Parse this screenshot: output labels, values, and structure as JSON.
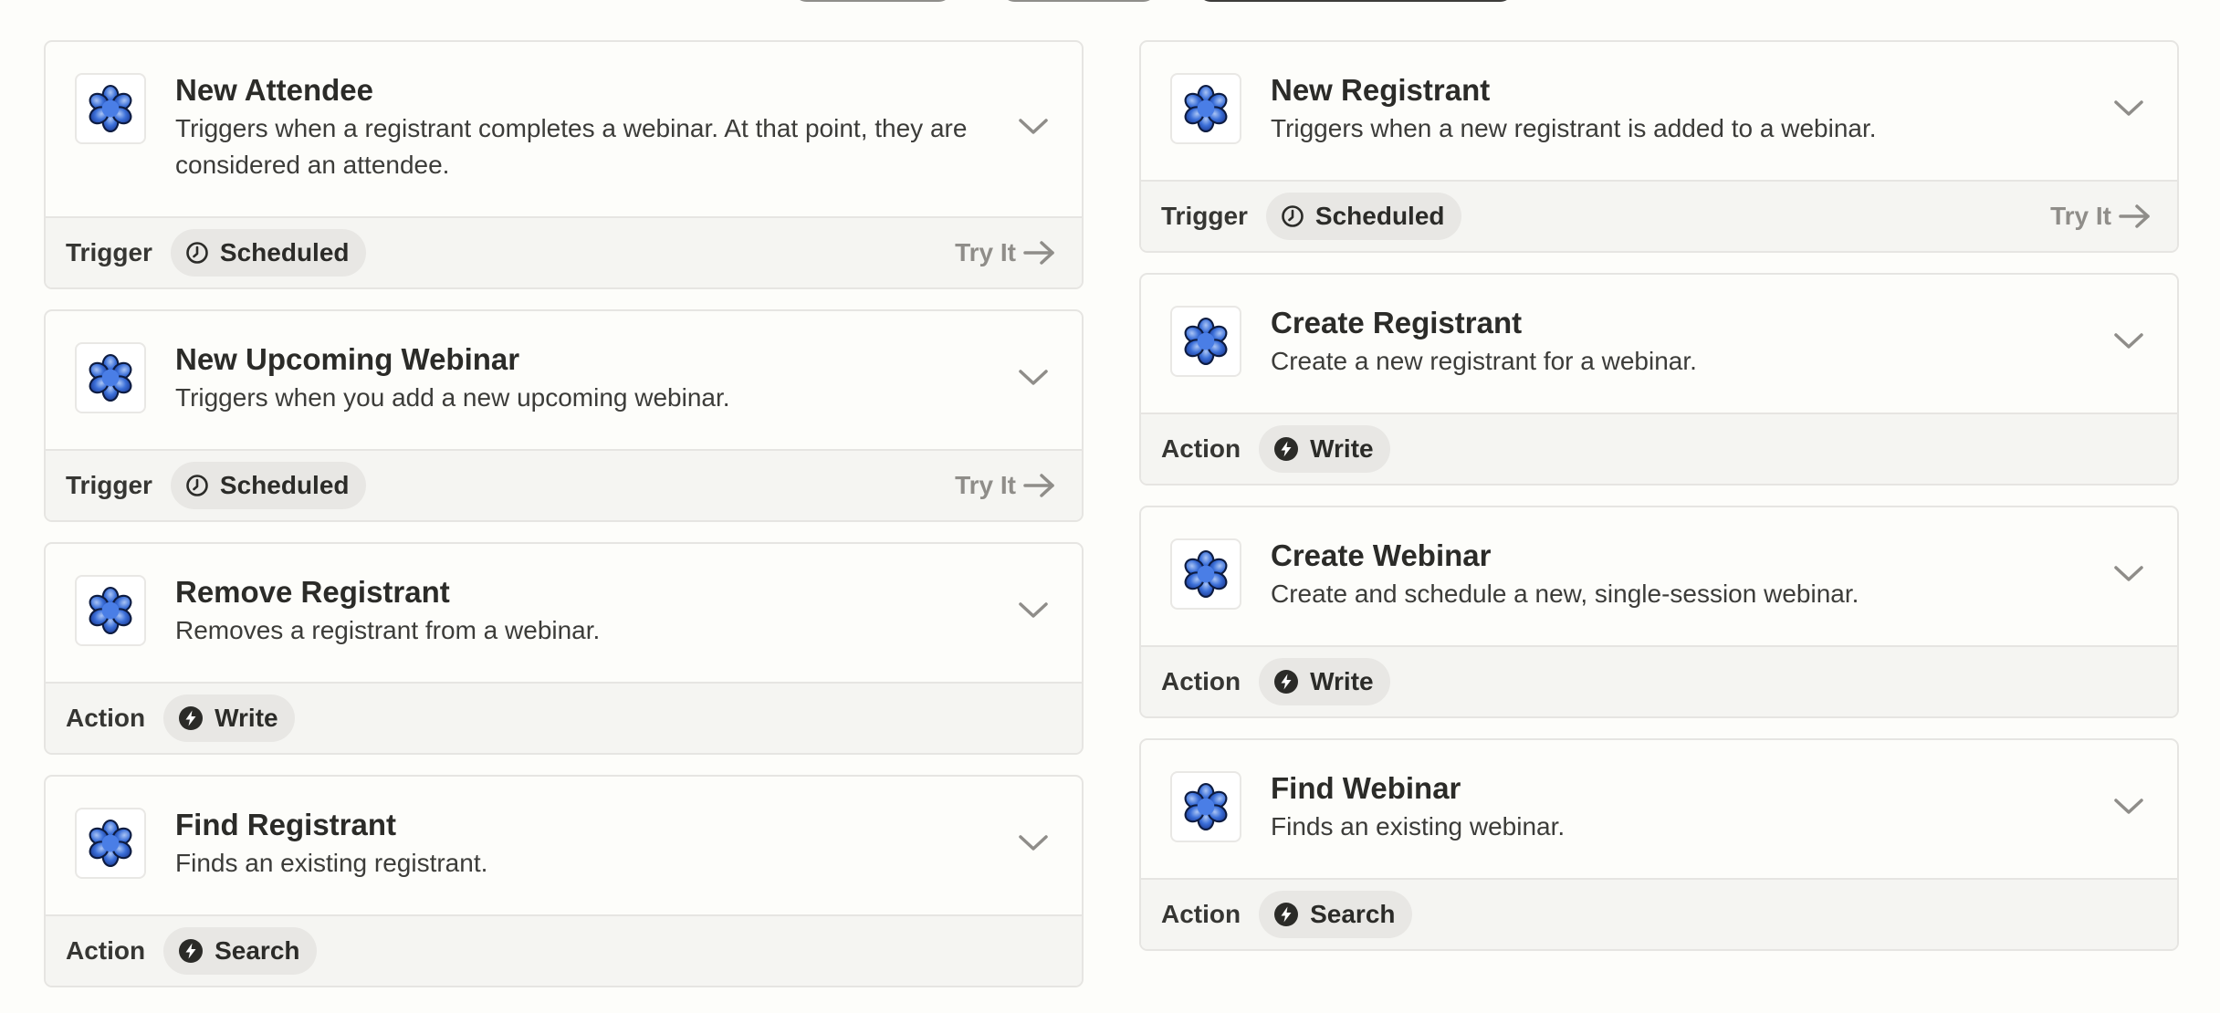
{
  "top_buttons": [
    {
      "style": "outline"
    },
    {
      "style": "outline"
    },
    {
      "style": "dark"
    }
  ],
  "colors": {
    "page_bg": "#fdfdfa",
    "footer_bg": "#f5f5f2",
    "badge_bg": "#e8e7e4",
    "border": "#e6e5e2",
    "muted": "#8f8d89",
    "text": "#2b2b28",
    "icon_blue": "#3b6fd8"
  },
  "left_column": [
    {
      "title": "New Attendee",
      "description": "Triggers when a registrant completes a webinar. At that point, they are considered an attendee.",
      "type": "Trigger",
      "badge": {
        "icon": "clock-icon",
        "label": "Scheduled"
      },
      "try_it": "Try It"
    },
    {
      "title": "New Upcoming Webinar",
      "description": "Triggers when you add a new upcoming webinar.",
      "type": "Trigger",
      "badge": {
        "icon": "clock-icon",
        "label": "Scheduled"
      },
      "try_it": "Try It"
    },
    {
      "title": "Remove Registrant",
      "description": "Removes a registrant from a webinar.",
      "type": "Action",
      "badge": {
        "icon": "bolt-icon",
        "label": "Write"
      }
    },
    {
      "title": "Find Registrant",
      "description": "Finds an existing registrant.",
      "type": "Action",
      "badge": {
        "icon": "bolt-icon",
        "label": "Search"
      }
    }
  ],
  "right_column": [
    {
      "title": "New Registrant",
      "description": "Triggers when a new registrant is added to a webinar.",
      "type": "Trigger",
      "badge": {
        "icon": "clock-icon",
        "label": "Scheduled"
      },
      "try_it": "Try It"
    },
    {
      "title": "Create Registrant",
      "description": "Create a new registrant for a webinar.",
      "type": "Action",
      "badge": {
        "icon": "bolt-icon",
        "label": "Write"
      }
    },
    {
      "title": "Create Webinar",
      "description": "Create and schedule a new, single-session webinar.",
      "type": "Action",
      "badge": {
        "icon": "bolt-icon",
        "label": "Write"
      }
    },
    {
      "title": "Find Webinar",
      "description": "Finds an existing webinar.",
      "type": "Action",
      "badge": {
        "icon": "bolt-icon",
        "label": "Search"
      }
    }
  ]
}
